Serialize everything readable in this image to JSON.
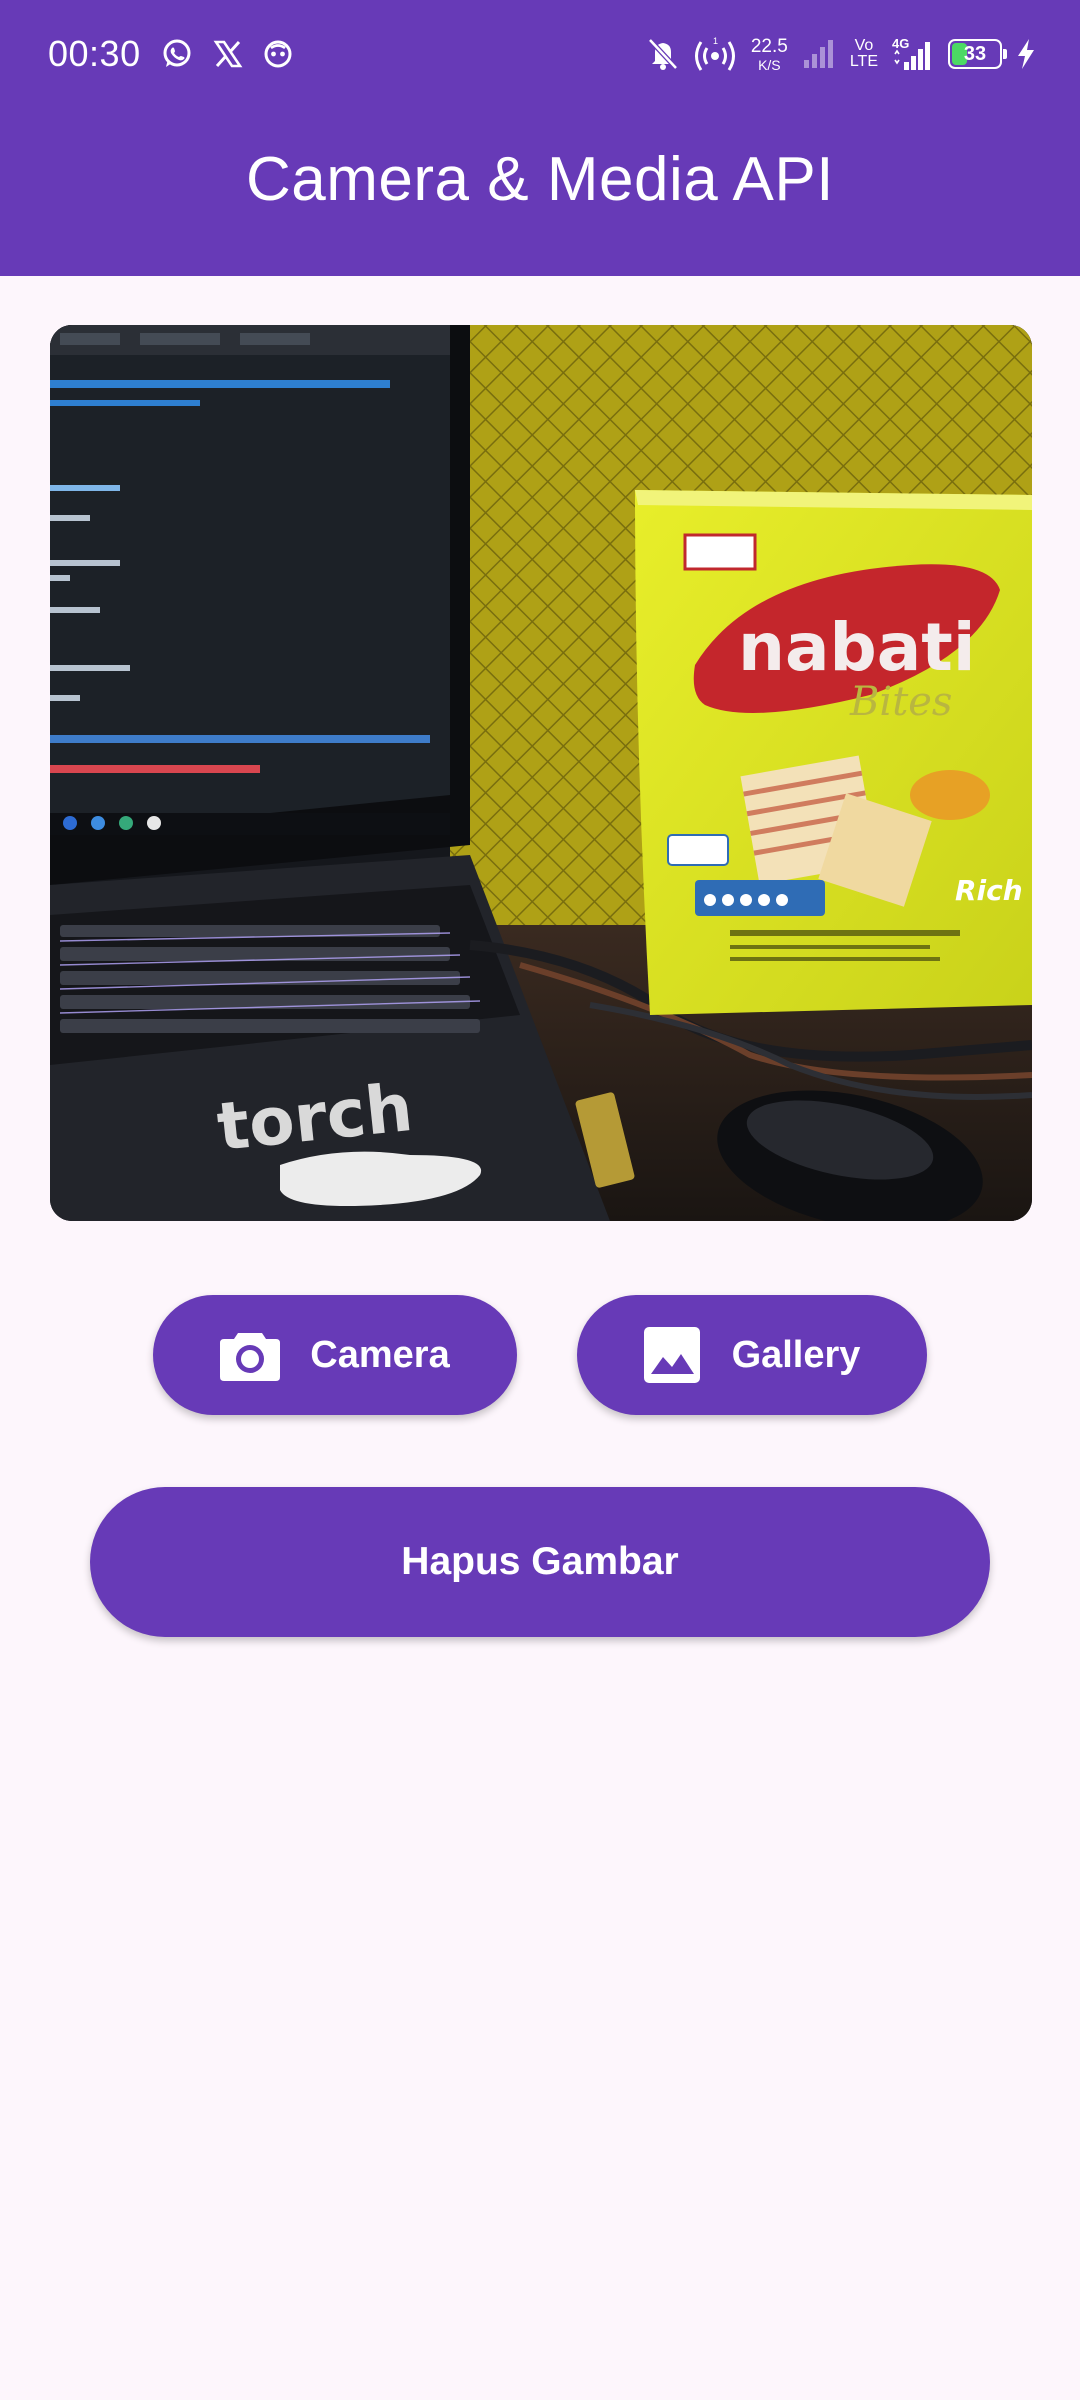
{
  "status_bar": {
    "time": "00:30",
    "left_icons": [
      "whatsapp-icon",
      "x-twitter-icon",
      "notification-app-icon"
    ],
    "right_icons": [
      "bell-muted-icon",
      "hotspot-icon",
      "signal-icon",
      "volte-icon",
      "signal-4g-icon",
      "battery-icon",
      "charging-icon"
    ],
    "net_speed_value": "22.5",
    "net_speed_unit": "K/S",
    "volte_top": "Vo",
    "volte_bottom": "LTE",
    "network_type": "4G",
    "battery_level": "33",
    "battery_fraction": 0.33,
    "accent_color": "#673AB7",
    "battery_color": "#4CD964"
  },
  "app_bar": {
    "title": "Camera & Media API"
  },
  "preview": {
    "description_icon": "photo-preview",
    "screen_code_lines": [
      "torch",
      "nabati",
      "Bites",
      "Rich"
    ]
  },
  "buttons": {
    "camera_label": "Camera",
    "camera_icon": "camera-icon",
    "gallery_label": "Gallery",
    "gallery_icon": "image-icon",
    "delete_label": "Hapus Gambar"
  }
}
